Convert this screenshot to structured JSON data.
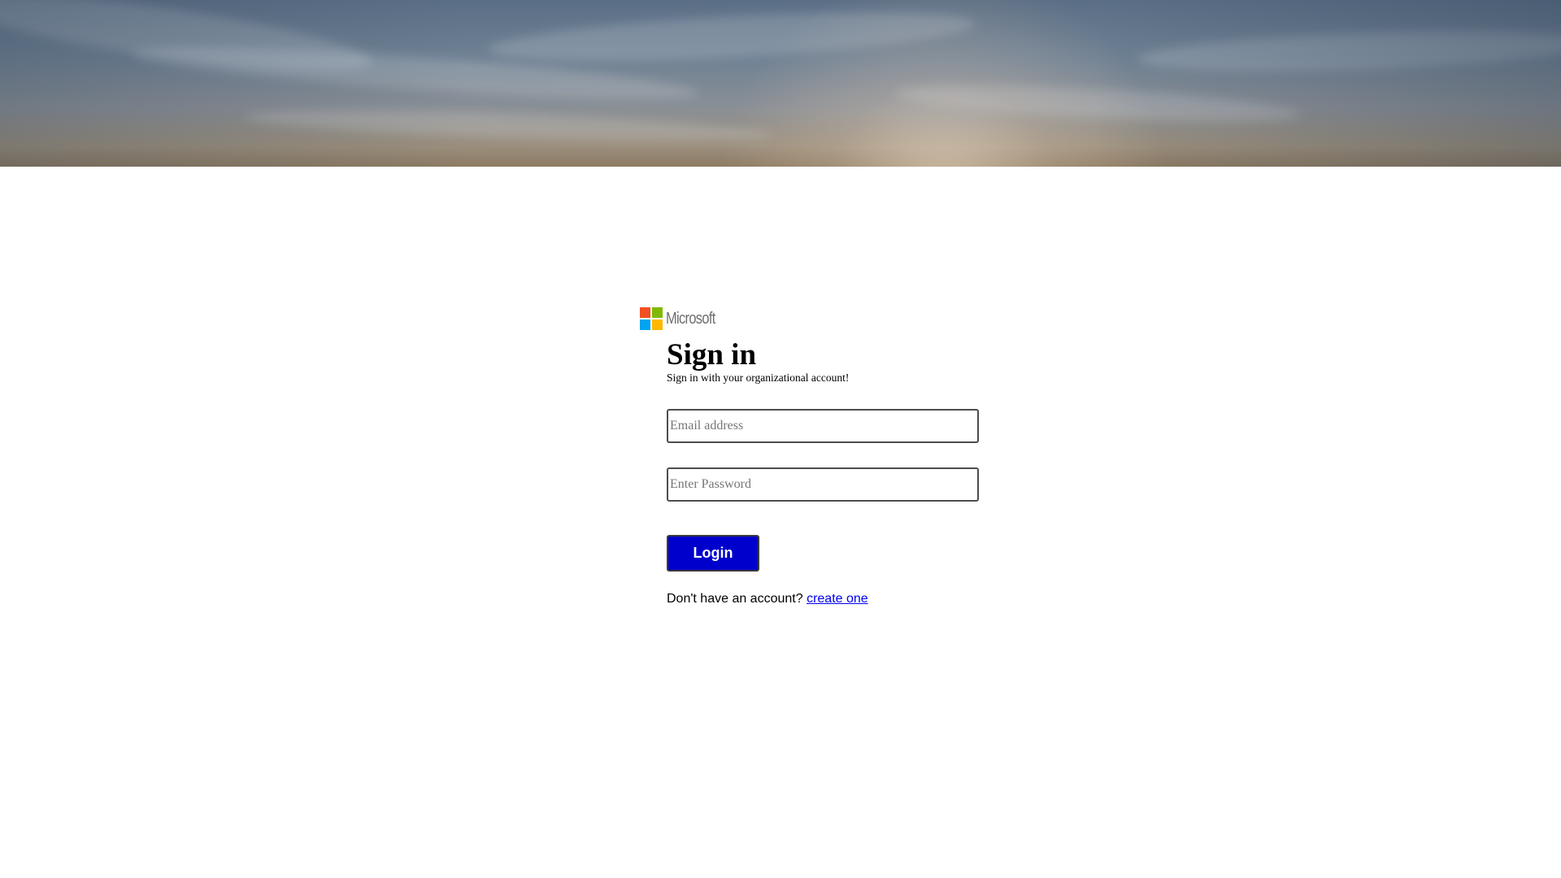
{
  "brand": {
    "logo_text": "Microsoft",
    "logo_colors": [
      "#f25022",
      "#7fba00",
      "#00a4ef",
      "#ffb900"
    ]
  },
  "signin": {
    "title": "Sign in",
    "subtitle": "Sign in with your organizational account!",
    "email_placeholder": "Email address",
    "email_value": "",
    "password_placeholder": "Enter Password",
    "password_value": "",
    "login_label": "Login",
    "login_color": "#0000cd",
    "signup_prompt": "Don't have an account?",
    "signup_link": "create one"
  }
}
